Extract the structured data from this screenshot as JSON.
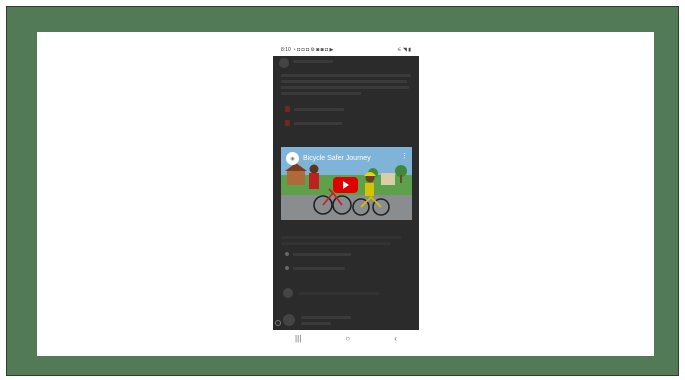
{
  "status_bar": {
    "time": "8:10",
    "left_icons": "◔ ◘ ◘ ◘ ⚙ ◙ ◙ ◘ ▶",
    "right_icons": "⚟ ◥ ▮"
  },
  "video": {
    "title": "Bicycle Safer Journey",
    "menu": "⋮"
  },
  "nav": {
    "recents": "|||",
    "home": "○",
    "back": "‹"
  },
  "colors": {
    "frame_green": "#527a56",
    "youtube_red": "#e00000",
    "sky": "#7fb4d8",
    "grass": "#5da14b"
  }
}
